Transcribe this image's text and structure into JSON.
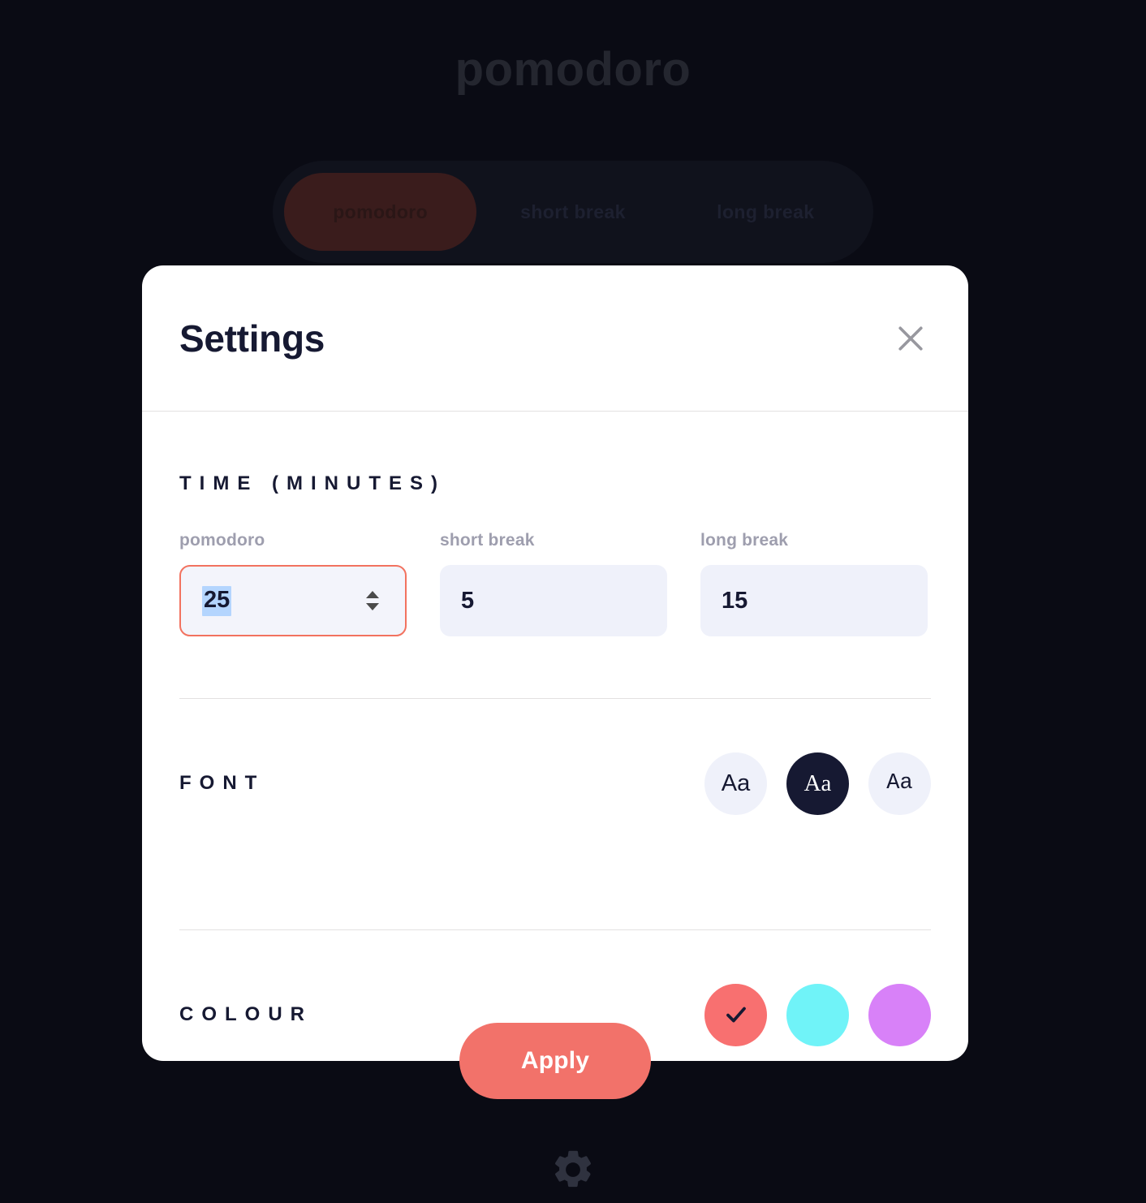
{
  "background": {
    "app_title": "pomodoro",
    "tabs": [
      {
        "label": "pomodoro",
        "active": true
      },
      {
        "label": "short break",
        "active": false
      },
      {
        "label": "long break",
        "active": false
      }
    ],
    "settings_icon": "gear-icon"
  },
  "modal": {
    "title": "Settings",
    "close_icon": "close-icon",
    "time": {
      "section_label": "TIME (MINUTES)",
      "fields": [
        {
          "caption": "pomodoro",
          "value": "25",
          "focused": true,
          "selected": true
        },
        {
          "caption": "short break",
          "value": "5",
          "focused": false,
          "selected": false
        },
        {
          "caption": "long break",
          "value": "15",
          "focused": false,
          "selected": false
        }
      ]
    },
    "font": {
      "section_label": "FONT",
      "options": [
        {
          "sample": "Aa",
          "style": "kumbh",
          "selected": false
        },
        {
          "sample": "Aa",
          "style": "roboto-slab",
          "selected": true
        },
        {
          "sample": "Aa",
          "style": "space-mono",
          "selected": false
        }
      ]
    },
    "colour": {
      "section_label": "COLOUR",
      "options": [
        {
          "name": "red",
          "hex": "#F87070",
          "selected": true
        },
        {
          "name": "cyan",
          "hex": "#70F3F8",
          "selected": false
        },
        {
          "name": "purple",
          "hex": "#D881F8",
          "selected": false
        }
      ]
    },
    "apply_label": "Apply"
  },
  "theme": {
    "page_bg": "#0a0b14",
    "modal_bg": "#ffffff",
    "accent": "#F2726A",
    "dark_navy": "#161932",
    "field_bg": "#EFF1FA",
    "muted_text": "#9E9EAE",
    "divider": "#E3E1E1",
    "selection_highlight": "#B4D5FE"
  }
}
